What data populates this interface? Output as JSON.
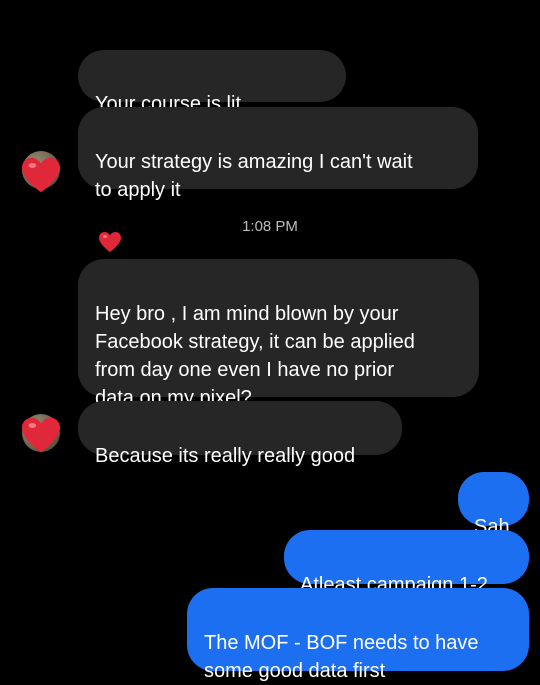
{
  "colors": {
    "background": "#000000",
    "incoming_bubble": "#262626",
    "outgoing_bubble": "#1d6ff2",
    "heart": "#e0283a",
    "timestamp_text": "#bdbdbd"
  },
  "thread": {
    "group1": {
      "msg1": "Your course is lit",
      "msg1_emojis": [
        "heart-emoji",
        "heart-emoji"
      ],
      "msg2": "Your strategy is amazing I can't wait\nto apply it",
      "avatar_reaction": "heart-emoji"
    },
    "timestamp": "1:08 PM",
    "group2": {
      "msg1": "Hey bro , I am mind blown by your\nFacebook strategy, it can be applied\nfrom day one even I have no prior\ndata on my pixel?",
      "msg2": "Because its really really good",
      "avatar_reaction": "heart-emoji"
    },
    "outgoing": {
      "msg1": "Sah",
      "msg2": "Atleast campaign 1-2",
      "msg3": "The MOF - BOF needs to have\nsome good data first"
    }
  }
}
